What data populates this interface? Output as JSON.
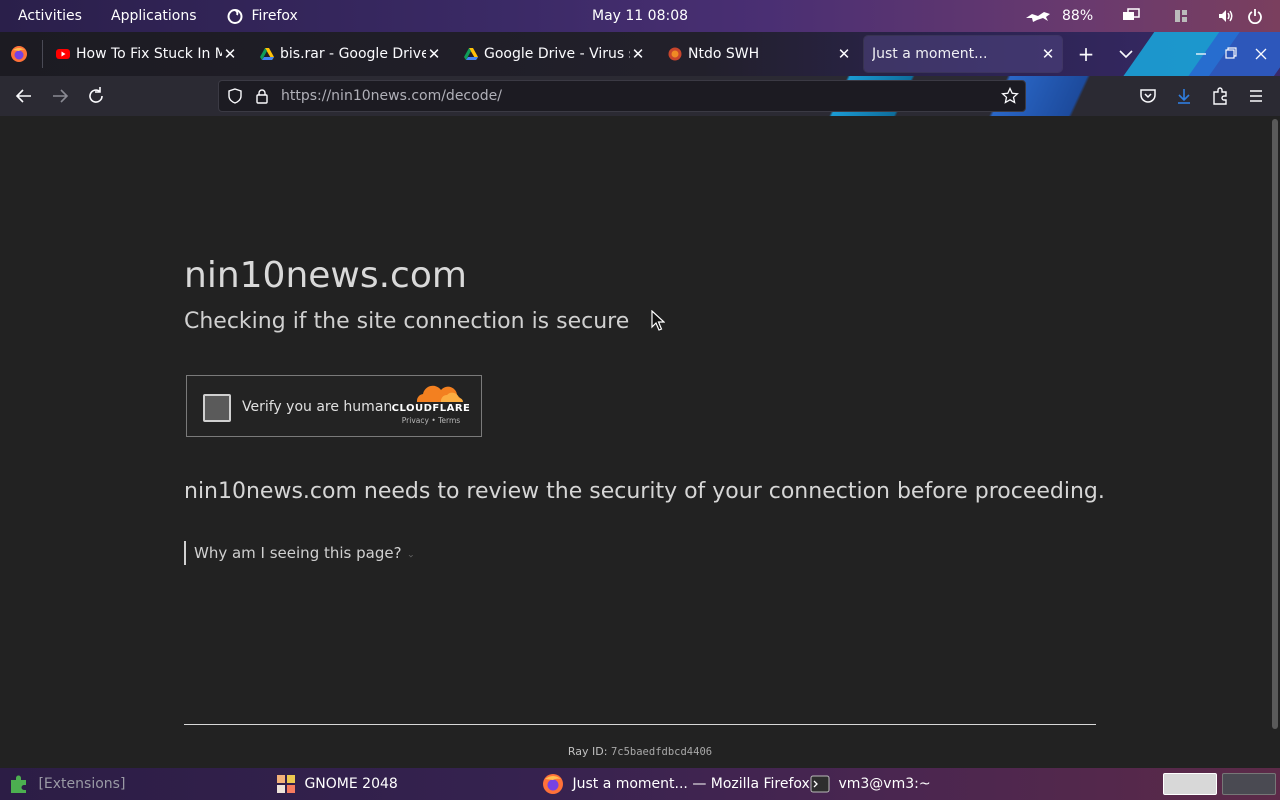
{
  "topbar": {
    "activities": "Activities",
    "applications": "Applications",
    "app_name": "Firefox",
    "clock": "May 11  08:08",
    "battery": "88%"
  },
  "tabs": [
    {
      "title": "How To Fix Stuck In M",
      "favicon": "youtube-icon",
      "active": false
    },
    {
      "title": "bis.rar - Google Drive",
      "favicon": "google-drive-icon",
      "active": false
    },
    {
      "title": "Google Drive - Virus sc",
      "favicon": "google-drive-icon",
      "active": false
    },
    {
      "title": "Ntdo SWH",
      "favicon": "ntdo-icon",
      "active": false
    },
    {
      "title": "Just a moment...",
      "favicon": "none",
      "active": true
    }
  ],
  "navbar": {
    "url_host": "https://nin10news.com",
    "url_path": "/decode/"
  },
  "page": {
    "site_name": "nin10news.com",
    "subtitle": "Checking if the site connection is secure",
    "captcha_label": "Verify you are human",
    "captcha_brand": "CLOUDFLARE",
    "captcha_links": "Privacy • Terms",
    "review_text": "nin10news.com needs to review the security of your connection before proceeding.",
    "why_link": "Why am I seeing this page?",
    "ray_label": "Ray ID:",
    "ray_id": "7c5baedfdbcd4406"
  },
  "taskbar": {
    "extensions": "[Extensions]",
    "gnome2048": "GNOME 2048",
    "firefox_window": "Just a moment... — Mozilla Firefox",
    "terminal": "vm3@vm3:~"
  },
  "colors": {
    "cloudflare_orange": "#f38020",
    "youtube_red": "#ff0000",
    "page_bg": "#222222"
  }
}
